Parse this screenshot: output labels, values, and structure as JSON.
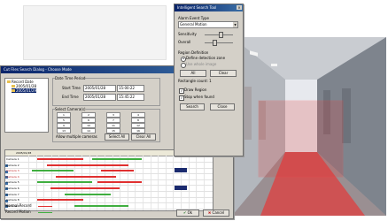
{
  "colors": {
    "title_bar": "#0a246a",
    "recording_red": "#e03030",
    "recording_green": "#3fae3f",
    "detection_zone": "#e23a3a",
    "event_block": "#1a2a6e"
  },
  "search_window": {
    "title": "Cut Files Search Dialog - Choose Mode",
    "tree": {
      "root": "Record Date",
      "items": [
        "2005/01/28",
        "2005/01/29"
      ]
    },
    "period": {
      "group_label": "Date Time Period",
      "start_label": "Start Time",
      "start_date": "2005/01/28",
      "start_time": "15:00:22",
      "end_label": "End Time",
      "end_date": "2005/01/28",
      "end_time": "15:45:22"
    },
    "cameras": {
      "group_label": "Select Camera(s)",
      "items": [
        "1",
        "2",
        "3",
        "4",
        "5",
        "6",
        "7",
        "8",
        "9",
        "10",
        "11",
        "12",
        "13",
        "14",
        "15",
        "16"
      ],
      "allow_multi": "Allow multiple cameras",
      "select_all": "Select All",
      "clear_all": "Clear All"
    },
    "timeline": {
      "header": "2005/01/28",
      "rows": [
        "Camera 1",
        "Camera 2",
        "Camera 3",
        "Camera 4",
        "Camera 5",
        "Camera 6",
        "Camera 7",
        "Camera 8",
        "Camera 9"
      ]
    },
    "legend": {
      "normal": "Normal Record",
      "motion": "Record Motion"
    },
    "ok": "Ok",
    "cancel": "Cancel"
  },
  "intel_window": {
    "title": "Intelligent Search Tool",
    "alarm_label": "Alarm Event Type",
    "alarm_value": "General Motion",
    "sensitivity_label": "Sensitivity",
    "sensitivity_level": 0.55,
    "overall_label": "Overall",
    "overall_level": 0.35,
    "region_label": "Region Definition",
    "define_zone": "Define detection zone",
    "use_all": "Use whole image",
    "all_button": "All",
    "clear_button": "Clear",
    "rect_count": "Rectangle count: 1",
    "draw_region": "Draw Region",
    "stop_when_found": "Stop when found",
    "search_button": "Search",
    "close_button": "Close"
  }
}
